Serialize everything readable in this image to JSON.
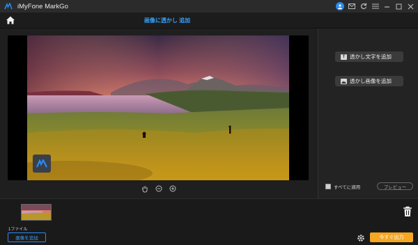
{
  "app": {
    "title": "iMyFone MarkGo"
  },
  "toolbar": {
    "page_title": "画像に透かし 追加"
  },
  "right_panel": {
    "add_text_watermark": "透かし文字を追加",
    "add_image_watermark": "透かし画像を追加",
    "apply_all_label": "すべてに適用",
    "preview_label": "プレビュー"
  },
  "strip": {
    "file_count": "1ファイル"
  },
  "bottom": {
    "add_image_label": "画像を追加",
    "export_label": "今すぐ出力"
  },
  "colors": {
    "accent_blue": "#2a8af0",
    "export_orange": "#f5a623",
    "title_blue": "#36a3ff"
  },
  "icons": [
    "app-logo-icon",
    "user-icon",
    "mail-icon",
    "refresh-icon",
    "menu-icon",
    "minimize-icon",
    "maximize-icon",
    "close-icon",
    "home-icon",
    "hand-icon",
    "zoom-out-icon",
    "zoom-in-icon",
    "text-icon",
    "image-icon",
    "trash-icon",
    "gear-icon"
  ]
}
